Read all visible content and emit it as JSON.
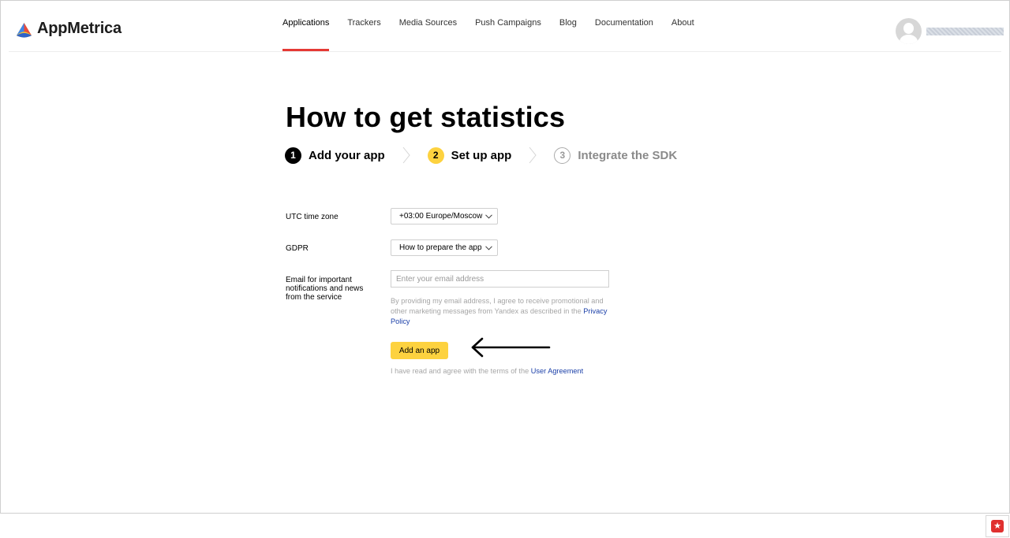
{
  "header": {
    "brand": "AppMetrica",
    "nav": [
      {
        "label": "Applications",
        "active": true
      },
      {
        "label": "Trackers"
      },
      {
        "label": "Media Sources"
      },
      {
        "label": "Push Campaigns"
      },
      {
        "label": "Blog"
      },
      {
        "label": "Documentation"
      },
      {
        "label": "About"
      }
    ]
  },
  "page": {
    "title": "How to get statistics",
    "steps": [
      {
        "number": "1",
        "label": "Add your app"
      },
      {
        "number": "2",
        "label": "Set up app"
      },
      {
        "number": "3",
        "label": "Integrate the SDK"
      }
    ]
  },
  "form": {
    "timezone_label": "UTC time zone",
    "timezone_value": "+03:00 Europe/Moscow",
    "gdpr_label": "GDPR",
    "gdpr_value": "How to prepare the app",
    "email_label": "Email for important notifications and news from the service",
    "email_placeholder": "Enter your email address",
    "email_value": "",
    "consent_text": "By providing my email address, I agree to receive promotional and other marketing messages from Yandex as described in the",
    "privacy_link": "Privacy Policy",
    "add_button": "Add an app",
    "agreement_text": "I have read and agree with the terms of the",
    "agreement_link": "User Agreement"
  },
  "colors": {
    "accent": "#fdd23f",
    "active_tab": "#e53935",
    "link": "#1a3fa8"
  },
  "icons": {
    "logo": "appmetrica-logo-icon",
    "avatar": "user-avatar-icon",
    "chevron": "chevron-down-icon",
    "step_separator": "chevron-right-icon",
    "arrow": "arrow-left-icon"
  }
}
